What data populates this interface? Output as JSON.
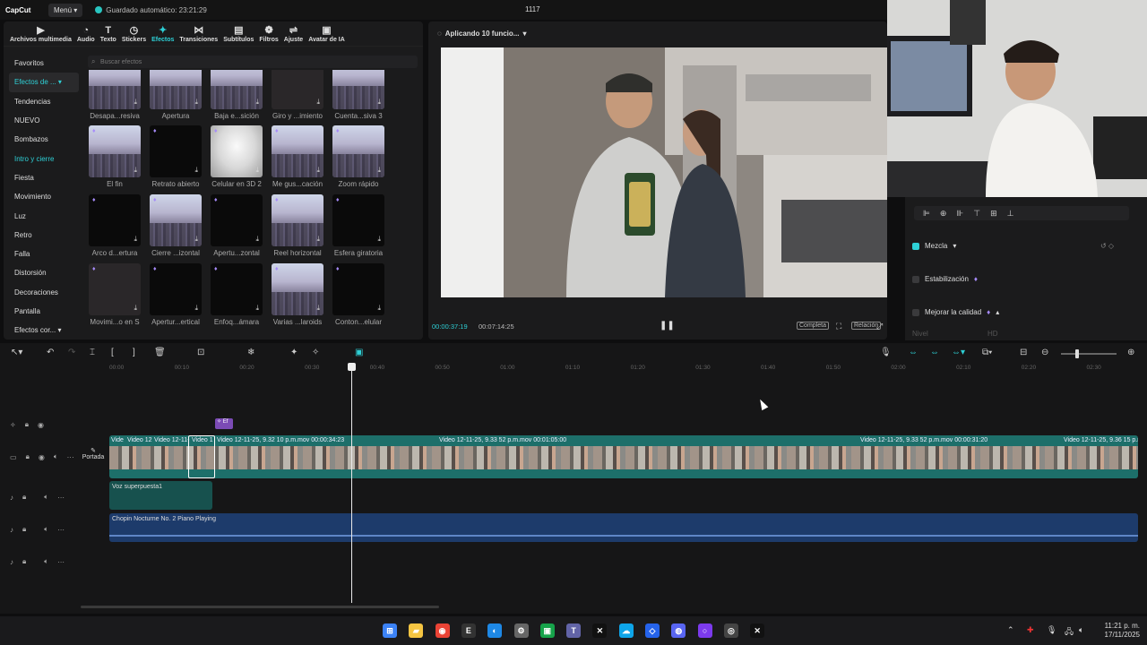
{
  "titlebar": {
    "logo": "CapCut",
    "menu_label": "Menú",
    "autosave": "Guardado automático: 23:21:29",
    "project_title": "1117"
  },
  "toolbar": [
    {
      "label": "Archivos multimedia",
      "icon": "media-icon"
    },
    {
      "label": "Audio",
      "icon": "audio-icon"
    },
    {
      "label": "Texto",
      "icon": "text-icon"
    },
    {
      "label": "Stickers",
      "icon": "sticker-icon"
    },
    {
      "label": "Efectos",
      "icon": "effects-icon",
      "active": true
    },
    {
      "label": "Transiciones",
      "icon": "transition-icon"
    },
    {
      "label": "Subtítulos",
      "icon": "subtitle-icon"
    },
    {
      "label": "Filtros",
      "icon": "filter-icon"
    },
    {
      "label": "Ajuste",
      "icon": "adjust-icon"
    },
    {
      "label": "Avatar de IA",
      "icon": "avatar-icon"
    }
  ],
  "sidebar": [
    {
      "label": "Favoritos"
    },
    {
      "label": "Efectos de ...",
      "selected": true
    },
    {
      "label": "Tendencias"
    },
    {
      "label": "NUEVO"
    },
    {
      "label": "Bombazos"
    },
    {
      "label": "Intro y cierre",
      "teal": true
    },
    {
      "label": "Fiesta"
    },
    {
      "label": "Movimiento"
    },
    {
      "label": "Luz"
    },
    {
      "label": "Retro"
    },
    {
      "label": "Falla"
    },
    {
      "label": "Distorsión"
    },
    {
      "label": "Decoraciones"
    },
    {
      "label": "Pantalla"
    },
    {
      "label": "Efectos cor..."
    }
  ],
  "search": {
    "placeholder": "Buscar efectos"
  },
  "effects": [
    {
      "label": "Desapa...resiva",
      "style": "city"
    },
    {
      "label": "Apertura",
      "style": "city"
    },
    {
      "label": "Baja e...sición",
      "style": "city"
    },
    {
      "label": "Giro y ...imiento",
      "style": "gray"
    },
    {
      "label": "Cuenta...siva 3",
      "style": "city"
    },
    {
      "label": "El fin",
      "style": "city"
    },
    {
      "label": "Retrato abierto",
      "style": "dark"
    },
    {
      "label": "Celular en 3D 2",
      "style": "phone"
    },
    {
      "label": "Me gus...cación",
      "style": "city"
    },
    {
      "label": "Zoom rápido",
      "style": "city"
    },
    {
      "label": "Arco d...ertura",
      "style": "dark"
    },
    {
      "label": "Cierre ...izontal",
      "style": "city"
    },
    {
      "label": "Apertu...zontal",
      "style": "dark"
    },
    {
      "label": "Reel horizontal",
      "style": "city"
    },
    {
      "label": "Esfera giratoria",
      "style": "dark"
    },
    {
      "label": "Movimi...o en S",
      "style": "gray"
    },
    {
      "label": "Apertur...ertical",
      "style": "dark"
    },
    {
      "label": "Enfoq...ámara",
      "style": "dark"
    },
    {
      "label": "Varias ...laroids",
      "style": "city"
    },
    {
      "label": "Conton...elular",
      "style": "dark"
    }
  ],
  "player": {
    "title": "Aplicando 10 funcio...",
    "time_current": "00:00:37:19",
    "time_total": "00:07:14:25",
    "btn_full": "Completa",
    "btn_ratio": "Relación"
  },
  "properties": {
    "mezcla": "Mezcla",
    "estabilizacion": "Estabilización",
    "mejorar": "Mejorar la calidad",
    "nivel_label": "Nivel",
    "nivel_value": "HD"
  },
  "timeline": {
    "ticks": [
      "00:00",
      "00:10",
      "00:20",
      "00:30",
      "00:40",
      "00:50",
      "01:00",
      "01:10",
      "01:20",
      "01:30",
      "01:40",
      "01:50",
      "02:00",
      "02:10",
      "02:20",
      "02:30"
    ],
    "video_clips": [
      {
        "label": "Vide"
      },
      {
        "label": "Video 12"
      },
      {
        "label": "Video 12-11-"
      },
      {
        "label": "Video 1"
      },
      {
        "label": "Video 12-11-25, 9.32 10 p.m.mov  00:00:34:23"
      },
      {
        "label": "Video 12-11-25, 9.33 52 p.m.mov  00:01:05:00"
      },
      {
        "label": "Video 12-11-25, 9.33 52 p.m.mov  00:00:31:20"
      },
      {
        "label": "Video 12-11-25, 9.36 15 p.m."
      }
    ],
    "cover_label": "Portada",
    "voice_label": "Voz superpuesta1",
    "music_label": "Chopin Nocturne No. 2 Piano Playing"
  },
  "taskbar": {
    "icons": [
      "windows-icon",
      "explorer-icon",
      "chrome-icon",
      "epic-icon",
      "app-icon",
      "settings-icon",
      "app2-icon",
      "teams-icon",
      "capcut-icon",
      "onedrive-icon",
      "vscode-icon",
      "discord-icon",
      "cortana-icon",
      "obs-icon",
      "capcut2-icon"
    ],
    "time": "11:21 p. m.",
    "date": "17/11/2025"
  }
}
